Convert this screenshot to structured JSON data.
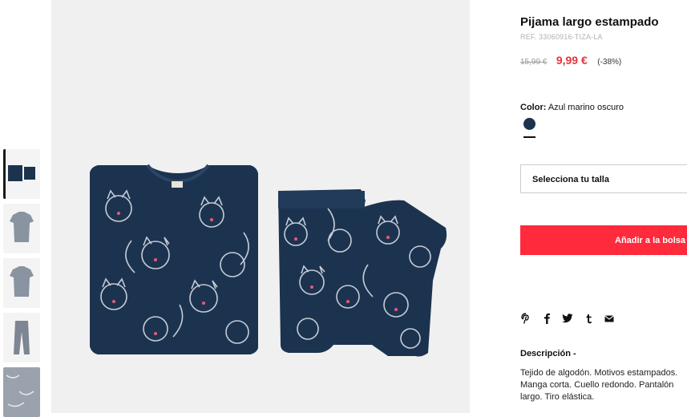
{
  "product": {
    "title": "Pijama largo estampado",
    "reference": "REF. 33060916-TIZA-LA",
    "old_price": "15,99 €",
    "price": "9,99 €",
    "discount": "(-38%)"
  },
  "color": {
    "label": "Color:",
    "value": "Azul marino oscuro",
    "swatch": "#1c3350"
  },
  "size": {
    "label": "Selecciona tu talla"
  },
  "cart": {
    "label": "Añadir a la bolsa"
  },
  "share": {
    "icons": [
      "pinterest-icon",
      "facebook-icon",
      "twitter-icon",
      "tumblr-icon",
      "email-icon"
    ]
  },
  "description": {
    "title": "Descripción -",
    "text": "Tejido de algodón. Motivos estampados. Manga corta. Cuello redondo. Pantalón largo. Tiro elástica."
  },
  "colors": {
    "accent": "#ff2a3c",
    "price": "#e8333c",
    "garment": "#1c3350"
  }
}
